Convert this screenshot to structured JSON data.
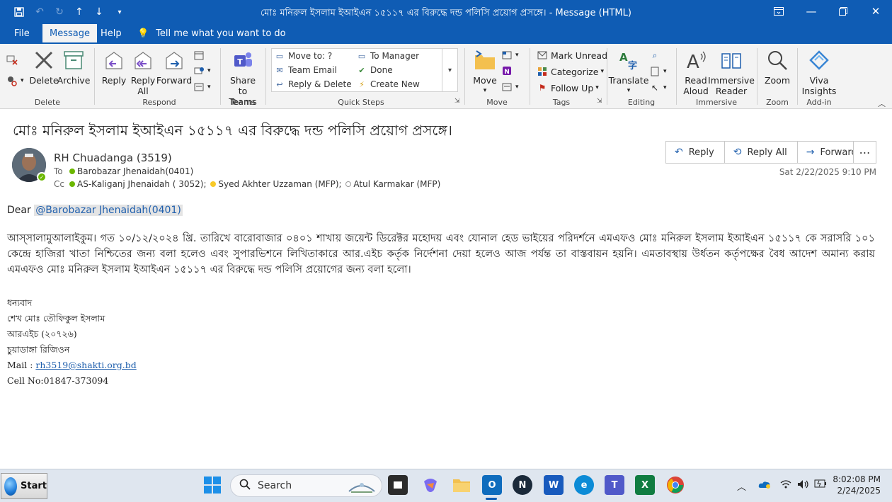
{
  "window": {
    "title": "মোঃ মনিরুল ইসলাম ইআইএন ১৫১১৭ এর বিরুদ্ধে দন্ড পলিসি  প্রয়োগ প্রসঙ্গে। - Message (HTML)"
  },
  "menubar": {
    "items": [
      "File",
      "Message",
      "Help"
    ],
    "active": "Message",
    "tell_me": "Tell me what you want to do"
  },
  "ribbon": {
    "groups": {
      "delete": "Delete",
      "respond": "Respond",
      "teams": "Teams",
      "quick_steps": "Quick Steps",
      "move": "Move",
      "tags": "Tags",
      "editing": "Editing",
      "immersive": "Immersive",
      "zoom": "Zoom",
      "addin": "Add-in"
    },
    "buttons": {
      "delete": "Delete",
      "archive": "Archive",
      "reply": "Reply",
      "reply_all_1": "Reply",
      "reply_all_2": "All",
      "forward": "Forward",
      "share_teams_1": "Share to",
      "share_teams_2": "Teams",
      "move": "Move",
      "mark_unread": "Mark Unread",
      "categorize": "Categorize",
      "follow_up": "Follow Up",
      "translate": "Translate",
      "read_aloud_1": "Read",
      "read_aloud_2": "Aloud",
      "immersive_reader_1": "Immersive",
      "immersive_reader_2": "Reader",
      "zoom": "Zoom",
      "viva_1": "Viva",
      "viva_2": "Insights"
    },
    "quick_steps": {
      "move_to": "Move to: ?",
      "to_manager": "To Manager",
      "team_email": "Team Email",
      "done": "Done",
      "reply_delete": "Reply & Delete",
      "create_new": "Create New"
    }
  },
  "message": {
    "subject": "মোঃ মনিরুল ইসলাম ইআইএন ১৫১১৭ এর বিরুদ্ধে দন্ড পলিসি  প্রয়োগ প্রসঙ্গে।",
    "sender": "RH Chuadanga (3519)",
    "to_label": "To",
    "to": "Barobazar Jhenaidah(0401)",
    "cc_label": "Cc",
    "cc": [
      "AS-Kaliganj Jhenaidah ( 3052);",
      "Syed Akhter Uzzaman (MFP);",
      "Atul  Karmakar (MFP)"
    ],
    "datetime": "Sat 2/22/2025 9:10 PM",
    "actions": {
      "reply": "Reply",
      "reply_all": "Reply All",
      "forward": "Forward"
    },
    "greeting": "Dear ",
    "mention": "@Barobazar Jhenaidah(0401)",
    "body": "আস্সালামুআলাইকুম। গত ১০/১২/২০২৪ খ্রি. তারিখে বারোবাজার ০৪০১ শাখায় জয়েন্ট ডিরেক্টর মহোদয় এবং যোনাল হেড ভাইয়ের পরিদর্শনে এমএফও  মোঃ মনিরুল ইসলাম ইআইএন ১৫১১৭ কে সরাসরি ১০১ কেন্দ্রে হাজিরা খাতা নিশ্চিতের জন্য বলা হলেও  এবং সুপারভিশনে লিখিতাকারে আর.এইচ কর্তৃক নির্দেশনা দেয়া হলেও আজ পর্যন্ত তা বাস্তবায়ন হয়নি। এমতাবস্থায় উর্ধতন কর্তৃপক্ষের বৈধ আদেশ অমান্য করায় এমএফও  মোঃ মনিরুল ইসলাম ইআইএন ১৫১১৭ এর বিরুদ্ধে দন্ড পলিসি প্রয়োগের জন্য বলা হলো।",
    "signature": {
      "thanks": "ধন্যবাদ",
      "name": "শেখ মোঃ তৌফিকুল ইসলাম",
      "title": "আরএইচ (২০৭২৬)",
      "region": "চুয়াডাঙ্গা রিজিওন",
      "mail_label": "Mail : ",
      "mail": "rh3519@shakti.org.bd",
      "cell": "Cell No:01847-373094"
    }
  },
  "taskbar": {
    "start": "Start",
    "search": "Search",
    "time": "8:02:08 PM",
    "date": "2/24/2025"
  },
  "colors": {
    "titlebar": "#0f5cb4",
    "ribbon": "#f3f3f3",
    "accent": "#1f5fad",
    "presence": "#6bb700"
  }
}
